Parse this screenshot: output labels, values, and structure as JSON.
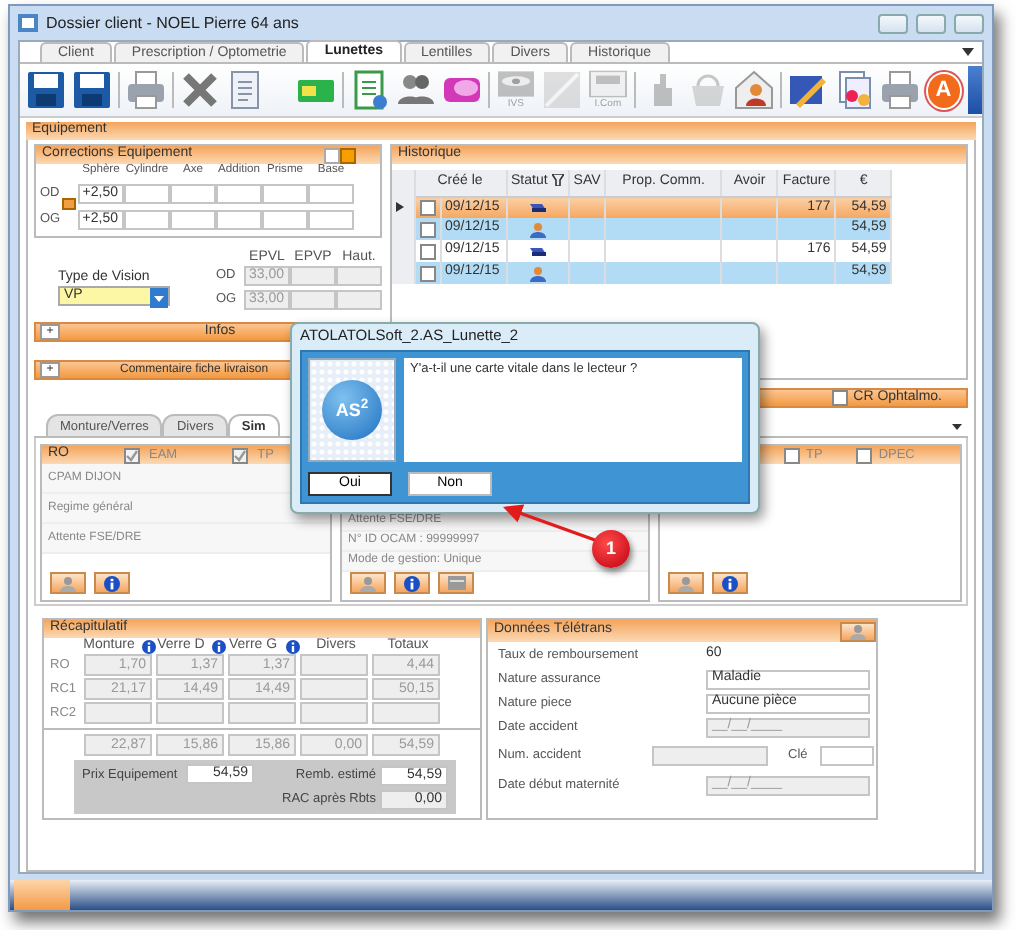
{
  "window": {
    "title": "Dossier client - NOEL Pierre 64 ans"
  },
  "tabs": [
    {
      "label": "Client",
      "selected": false
    },
    {
      "label": "Prescription / Optometrie",
      "selected": false
    },
    {
      "label": "Lunettes",
      "selected": true
    },
    {
      "label": "Lentilles",
      "selected": false
    },
    {
      "label": "Divers",
      "selected": false
    },
    {
      "label": "Historique",
      "selected": false
    }
  ],
  "toolbar": [
    {
      "kind": "floppy",
      "disabled": false
    },
    {
      "kind": "floppy",
      "disabled": false
    },
    {
      "kind": "separator"
    },
    {
      "kind": "printer",
      "disabled": false
    },
    {
      "kind": "separator"
    },
    {
      "kind": "cross",
      "disabled": false
    },
    {
      "kind": "document",
      "disabled": false
    },
    {
      "kind": "spacer"
    },
    {
      "kind": "card",
      "disabled": false
    },
    {
      "kind": "separator"
    },
    {
      "kind": "clipboard",
      "disabled": false
    },
    {
      "kind": "people",
      "disabled": false
    },
    {
      "kind": "bubble",
      "disabled": false
    },
    {
      "kind": "separator"
    },
    {
      "kind": "eye",
      "disabled": true,
      "caption": "IVS"
    },
    {
      "kind": "blank",
      "disabled": true
    },
    {
      "kind": "monitor",
      "disabled": true,
      "caption": "I.Com"
    },
    {
      "kind": "separator"
    },
    {
      "kind": "hand",
      "disabled": true
    },
    {
      "kind": "basket",
      "disabled": true
    },
    {
      "kind": "envelope",
      "disabled": false
    },
    {
      "kind": "separator"
    },
    {
      "kind": "pencil",
      "disabled": false
    },
    {
      "kind": "pages",
      "disabled": false
    },
    {
      "kind": "printer",
      "disabled": false
    },
    {
      "kind": "letter",
      "disabled": false,
      "caption": "A"
    }
  ],
  "section": {
    "title": "Equipement"
  },
  "corrections": {
    "title": "Corrections Equipement",
    "columns": [
      "Sphère",
      "Cylindre",
      "Axe",
      "Addition",
      "Prisme",
      "Base"
    ],
    "rows": [
      {
        "eye": "OD",
        "sphere": "+2,50"
      },
      {
        "eye": "OG",
        "sphere": "+2,50"
      }
    ]
  },
  "vision": {
    "label": "Type de Vision",
    "value": "VP"
  },
  "ep": {
    "columns": [
      "EPVL",
      "EPVP",
      "Haut."
    ],
    "rows": [
      {
        "eye": "OD",
        "epvl": "33,00"
      },
      {
        "eye": "OG",
        "epvl": "33,00"
      }
    ]
  },
  "collapsibles": [
    {
      "toggle": "+",
      "title": "Infos"
    },
    {
      "toggle": "+",
      "title": "Commentaire fiche livraison"
    }
  ],
  "historique": {
    "title": "Historique",
    "columns": [
      "Créé le",
      "Statut",
      "SAV",
      "Prop. Comm.",
      "Avoir",
      "Facture",
      "€"
    ],
    "rows": [
      {
        "selected": true,
        "highlighted": false,
        "checked": false,
        "kind": "stack",
        "created": "09/12/15",
        "facture": "177",
        "amount": "54,59"
      },
      {
        "selected": false,
        "highlighted": true,
        "checked": false,
        "kind": "figure",
        "created": "09/12/15",
        "amount": "54,59"
      },
      {
        "selected": false,
        "highlighted": false,
        "checked": false,
        "kind": "stack",
        "created": "09/12/15",
        "facture": "176",
        "amount": "54,59"
      },
      {
        "selected": false,
        "highlighted": true,
        "checked": false,
        "kind": "figure",
        "created": "09/12/15",
        "amount": "54,59"
      }
    ]
  },
  "cr_ophtalmo": {
    "label": "CR Ophtalmo.",
    "checked": false
  },
  "subtabs": [
    {
      "label": "Monture/Verres",
      "selected": false
    },
    {
      "label": "Divers",
      "selected": false
    },
    {
      "label": "Sim",
      "selected": true
    }
  ],
  "ro_panel": {
    "title": "RO",
    "options": [
      {
        "label": "EAM",
        "checked": true
      },
      {
        "label": "TP",
        "checked": true
      }
    ],
    "lines": [
      "CPAM DIJON",
      "Regime général",
      "Attente FSE/DRE"
    ]
  },
  "amc_panel": {
    "lines": [
      "Attente FSE/DRE",
      "N° ID OCAM : 99999997",
      "Mode de gestion: Unique"
    ]
  },
  "tp_panel": {
    "options": [
      {
        "label": "TP",
        "checked": false
      },
      {
        "label": "DPEC",
        "checked": false
      }
    ]
  },
  "recap": {
    "title": "Récapitulatif",
    "columns": [
      "Monture",
      "Verre D",
      "Verre G",
      "Divers",
      "Totaux"
    ],
    "rows": [
      {
        "label": "RO",
        "monture": "1,70",
        "verre_d": "1,37",
        "verre_g": "1,37",
        "totaux": "4,44"
      },
      {
        "label": "RC1",
        "monture": "21,17",
        "verre_d": "14,49",
        "verre_g": "14,49",
        "totaux": "50,15"
      },
      {
        "label": "RC2"
      }
    ],
    "totals": {
      "monture": "22,87",
      "verre_d": "15,86",
      "verre_g": "15,86",
      "divers": "0,00",
      "totaux": "54,59"
    },
    "prix_label": "Prix Equipement",
    "prix": "54,59",
    "remb_label": "Remb. estimé",
    "remb": "54,59",
    "rac_label": "RAC après Rbts",
    "rac": "0,00"
  },
  "teletrans": {
    "title": "Données Télétrans",
    "fields": [
      {
        "kind": "text",
        "label": "Taux de remboursement",
        "value": "60"
      },
      {
        "kind": "field",
        "label": "Nature assurance",
        "value": "Maladie"
      },
      {
        "kind": "field",
        "label": "Nature piece",
        "value": "Aucune pièce"
      },
      {
        "kind": "field",
        "label": "Date accident",
        "placeholder": "__/__/____"
      },
      {
        "kind": "split",
        "label": "Num. accident",
        "extra_label": "Clé"
      },
      {
        "kind": "field",
        "label": "Date début maternité",
        "placeholder": "__/__/____"
      }
    ]
  },
  "dialog": {
    "title": "ATOLATOLSoft_2.AS_Lunette_2",
    "logo": "AS$^{2}$",
    "message": "Y'a-t-il une carte vitale dans le lecteur ?",
    "buttons": [
      "Oui",
      "Non"
    ]
  },
  "callout": {
    "number": "1"
  }
}
